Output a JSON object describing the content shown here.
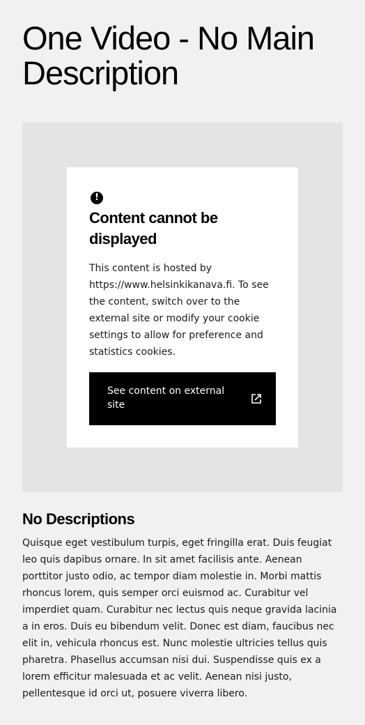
{
  "page": {
    "title": "One Video - No Main Description"
  },
  "embed": {
    "icon": "alert-circle-icon",
    "notice_title": "Content cannot be displayed",
    "notice_body_lines": [
      "This content is hosted by",
      "https://www.helsinkikanava.fi. To see",
      "the content, switch over to the",
      "external site or modify your cookie",
      "settings to allow for preference and",
      "statistics cookies."
    ],
    "button_label_lines": [
      "See content on external",
      "site"
    ],
    "button_icon": "external-link-icon"
  },
  "section": {
    "heading": "No Descriptions",
    "body_lines": [
      "Quisque eget vestibulum turpis, eget fringilla erat. Duis feugiat",
      "leo quis dapibus ornare. In sit amet facilisis ante. Aenean",
      "porttitor justo odio, ac tempor diam molestie in. Morbi mattis",
      "rhoncus lorem, quis semper orci euismod ac. Curabitur vel",
      "imperdiet quam. Curabitur nec lectus quis neque gravida lacinia",
      "a in eros. Duis eu bibendum velit. Donec est diam, faucibus nec",
      "elit in, vehicula rhoncus est. Nunc molestie ultricies tellus quis",
      "pharetra. Phasellus accumsan nisi dui. Suspendisse quis ex a",
      "lorem efficitur malesuada et ac velit. Aenean nisi justo,",
      "pellentesque id orci ut, posuere viverra libero."
    ]
  },
  "colors": {
    "page_background": "#f1f1f1",
    "embed_background": "#e4e4e4",
    "card_background": "#ffffff",
    "button_background": "#000000",
    "button_text": "#ffffff"
  }
}
